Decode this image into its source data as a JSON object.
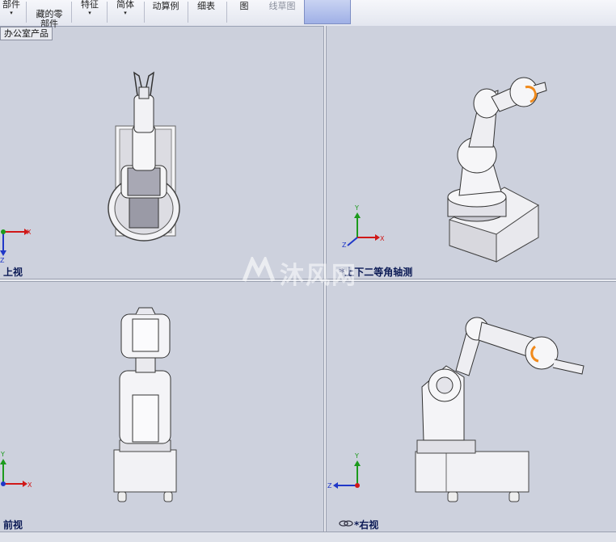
{
  "ribbon": {
    "items": [
      {
        "label": "部件",
        "arrow": "▾"
      },
      {
        "label": "藏的零\n部件",
        "arrow": ""
      },
      {
        "label": "特征",
        "arrow": "▾"
      },
      {
        "label": "简体",
        "arrow": "▾"
      },
      {
        "label": "动算例",
        "arrow": ""
      },
      {
        "label": "细表",
        "arrow": ""
      },
      {
        "label": "图",
        "arrow": ""
      },
      {
        "label": "线草图",
        "arrow": ""
      }
    ]
  },
  "document_tab": "办公室产品",
  "viewports": {
    "top_left": {
      "label": "上视"
    },
    "top_right": {
      "label": "*上下二等角轴测"
    },
    "bottom_left": {
      "label": "前视"
    },
    "bottom_right": {
      "label": "*右视"
    }
  },
  "axes": {
    "x": "X",
    "y": "Y",
    "z": "Z"
  },
  "watermark": "沐风网",
  "colors": {
    "accent_orange": "#f08a1c",
    "axis_x": "#d01818",
    "axis_y": "#1c9a1c",
    "axis_z": "#2038c8",
    "label": "#0b1a55"
  }
}
